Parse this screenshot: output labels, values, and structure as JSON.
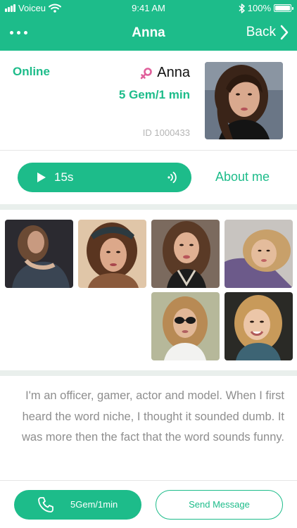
{
  "status_bar": {
    "carrier": "Voiceu",
    "time": "9:41 AM",
    "battery": "100%"
  },
  "nav": {
    "title": "Anna",
    "back_label": "Back"
  },
  "profile": {
    "status": "Online",
    "name": "Anna",
    "rate": "5 Gem/1 min",
    "user_id": "ID 1000433"
  },
  "voice": {
    "duration": "15s",
    "about_label": "About me"
  },
  "bio": "I'm an officer, gamer, actor and model. When I first heard the word niche, I thought it sounded dumb. It was more then the fact that the word sounds funny.",
  "actions": {
    "call_label": "5Gem/1min",
    "message_label": "Send Message"
  },
  "colors": {
    "accent": "#1dbc8a",
    "gender": "#e0609b"
  }
}
